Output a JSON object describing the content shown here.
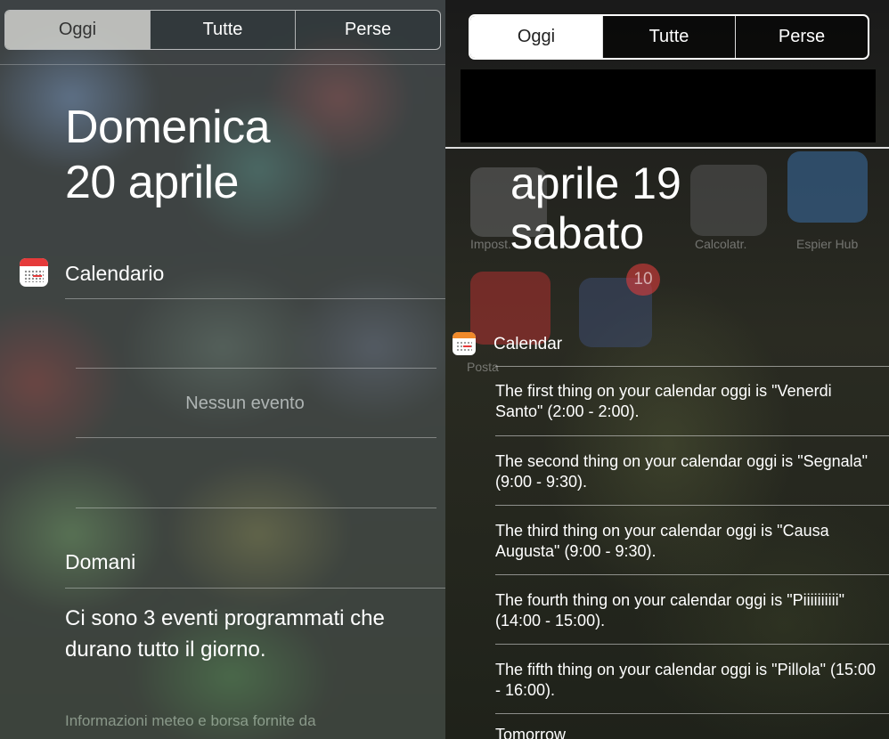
{
  "left": {
    "tabs": [
      {
        "label": "Oggi",
        "selected": true
      },
      {
        "label": "Tutte",
        "selected": false
      },
      {
        "label": "Perse",
        "selected": false
      }
    ],
    "date_weekday": "Domenica",
    "date_day": "20 aprile",
    "calendar_title": "Calendario",
    "no_event_text": "Nessun evento",
    "tomorrow_title": "Domani",
    "tomorrow_text": "Ci sono 3 eventi programmati che durano tutto il giorno.",
    "footer_text": "Informazioni meteo e borsa fornite da"
  },
  "right": {
    "tabs": [
      {
        "label": "Oggi",
        "selected": true
      },
      {
        "label": "Tutte",
        "selected": false
      },
      {
        "label": "Perse",
        "selected": false
      }
    ],
    "date_line1": "aprile 19",
    "date_line2": "sabato",
    "calendar_title": "Calendar",
    "events": [
      "The first thing on your calendar oggi is \"Venerdi Santo\" (2:00 - 2:00).",
      "The second thing on your calendar oggi is \"Segnala\" (9:00 - 9:30).",
      "The third thing on your calendar oggi is \"Causa Augusta\" (9:00 - 9:30).",
      "The fourth thing on your calendar oggi is \"Piiiiiiiiii\" (14:00 - 15:00).",
      "The fifth thing on your calendar oggi is \"Pillola\" (15:00 - 16:00)."
    ],
    "tomorrow_title": "Tomorrow",
    "background_apps": {
      "labels": [
        "Impost.",
        "Calcolatr.",
        "Espier Hub",
        "Posta"
      ],
      "badge": "10"
    }
  },
  "colors": {
    "ios_calendar_red": "#e53a3a",
    "android_calendar_orange": "#f08a2a"
  }
}
